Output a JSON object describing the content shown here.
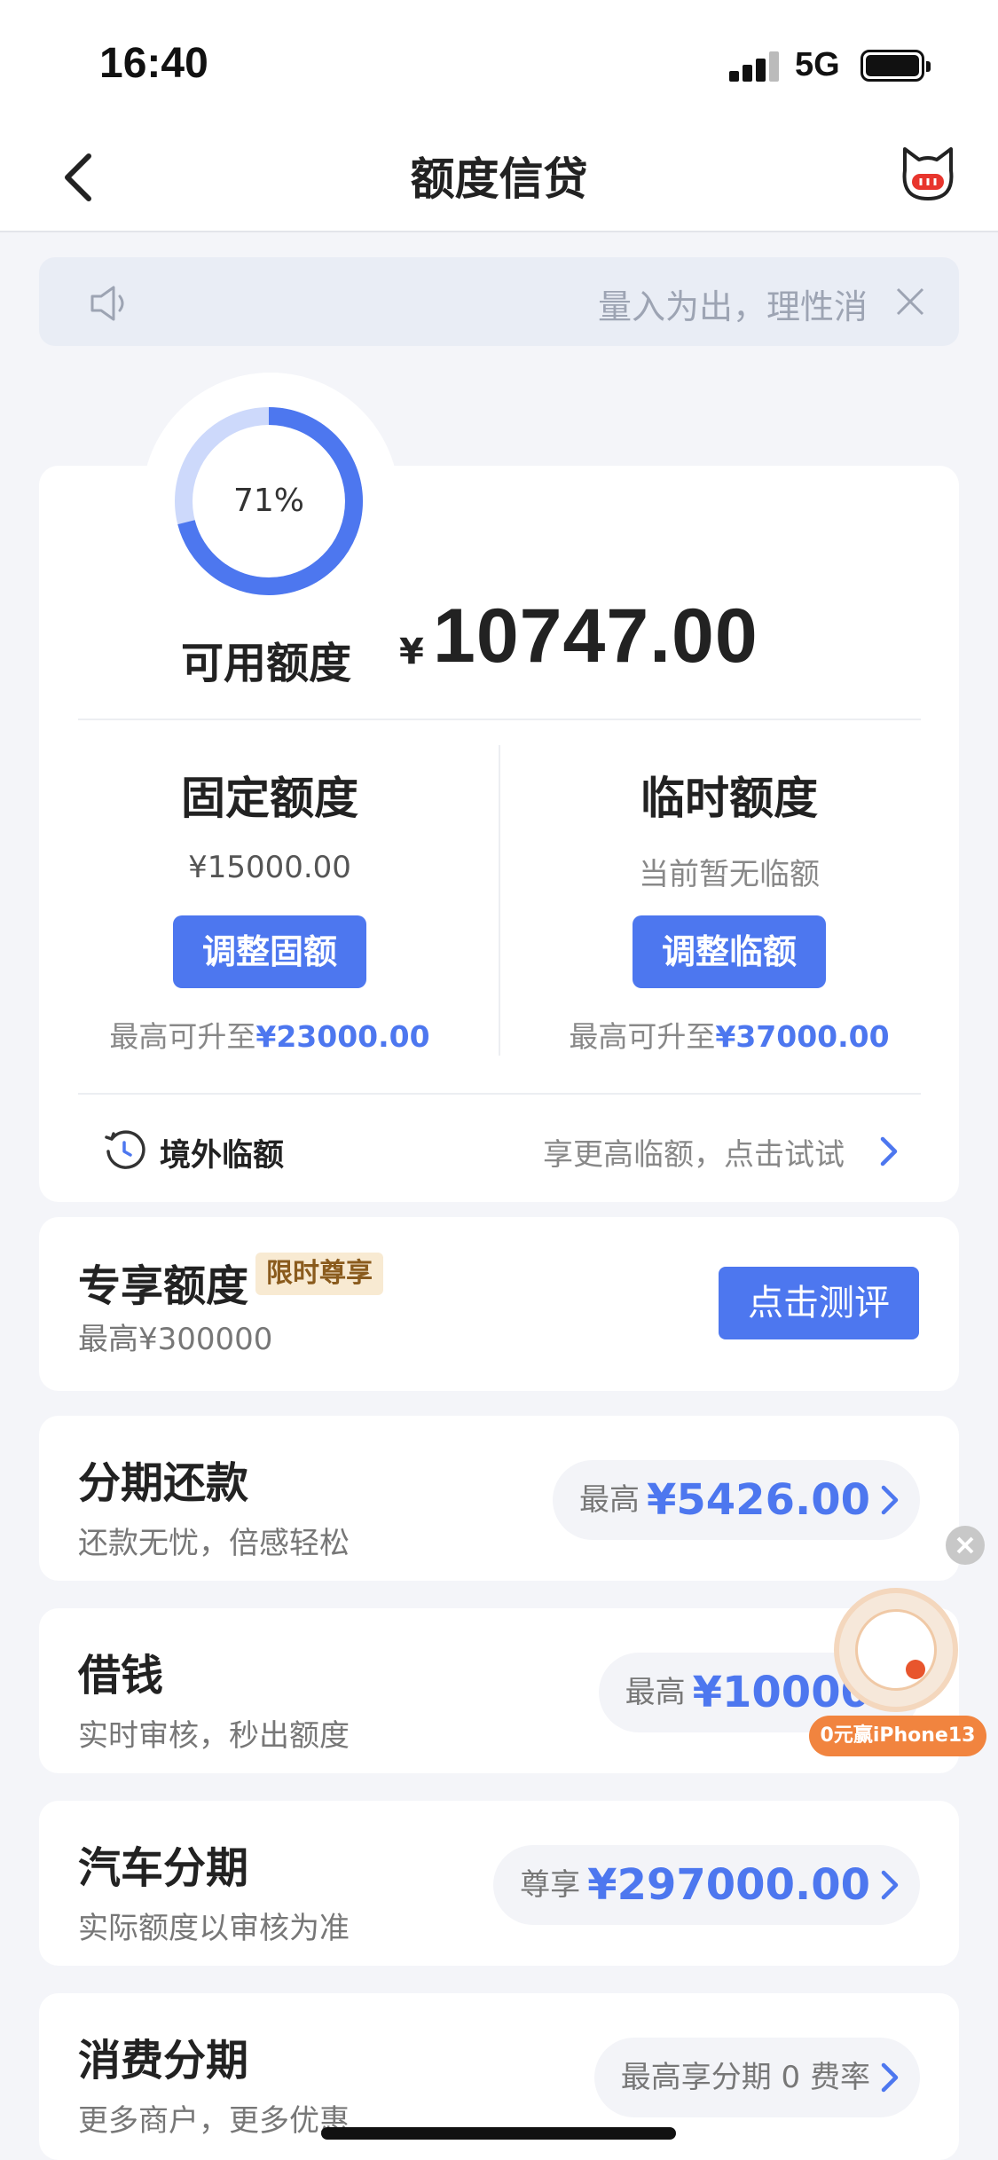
{
  "status_bar": {
    "time": "16:40",
    "network": "5G"
  },
  "nav": {
    "title": "额度信贷"
  },
  "notice": {
    "text": "量入为出，理性消费"
  },
  "credit": {
    "usage_percent_label": "71%",
    "usage_fraction": 0.71,
    "available_label": "可用额度",
    "currency_symbol": "¥",
    "available_amount": "10747.00",
    "fixed": {
      "title": "固定额度",
      "amount": "¥15000.00",
      "button": "调整固额",
      "max_prefix": "最高可升至",
      "max_amount": "¥23000.00"
    },
    "temporary": {
      "title": "临时额度",
      "status": "当前暂无临额",
      "button": "调整临额",
      "max_prefix": "最高可升至",
      "max_amount": "¥37000.00"
    },
    "overseas": {
      "label": "境外临额",
      "hint": "享更高临额，点击试试"
    }
  },
  "exclusive": {
    "title": "专享额度",
    "badge": "限时尊享",
    "subtitle": "最高¥300000",
    "button": "点击测评"
  },
  "rows": [
    {
      "title": "分期还款",
      "subtitle": "还款无忧，倍感轻松",
      "prefix": "最高",
      "amount": "¥5426.00"
    },
    {
      "title": "借钱",
      "subtitle": "实时审核，秒出额度",
      "prefix": "最高",
      "amount": "¥10000"
    },
    {
      "title": "汽车分期",
      "subtitle": "实际额度以审核为准",
      "prefix": "尊享",
      "amount": "¥297000.00"
    },
    {
      "title": "消费分期",
      "subtitle": "更多商户，更多优惠",
      "text": "最高享分期 0 费率"
    }
  ],
  "floating_promo": {
    "label": "0元赢iPhone13"
  },
  "colors": {
    "accent": "#4d77ef",
    "ring_track": "#cdd9fb",
    "badge_bg": "#f8ead2",
    "promo": "#f1843f"
  }
}
